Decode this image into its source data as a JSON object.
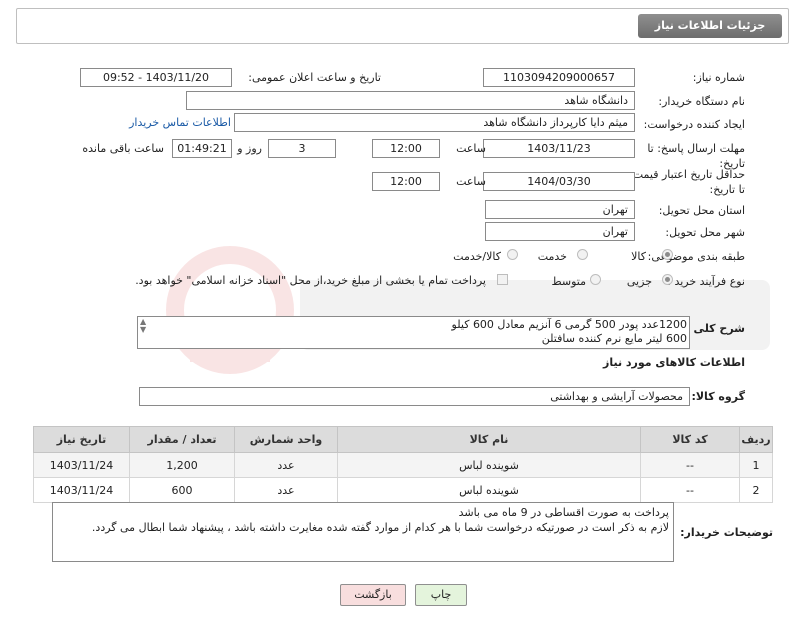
{
  "header": {
    "title": "جزئیات اطلاعات نیاز"
  },
  "fields": {
    "need_number_label": "شماره نیاز:",
    "need_number": "1103094209000657",
    "announce_label": "تاریخ و ساعت اعلان عمومی:",
    "announce_value": "1403/11/20 - 09:52",
    "buyer_org_label": "نام دستگاه خریدار:",
    "buyer_org": "دانشگاه شاهد",
    "requester_label": "ایجاد کننده درخواست:",
    "requester": "میثم دایا کارپرداز دانشگاه شاهد",
    "contact_link": "اطلاعات تماس خریدار",
    "deadline_label": "مهلت ارسال پاسخ: تا تاریخ:",
    "deadline_date": "1403/11/23",
    "time_label": "ساعت",
    "deadline_time": "12:00",
    "days_value": "3",
    "days_label": "روز و",
    "remaining_time": "01:49:21",
    "remaining_label": "ساعت باقی مانده",
    "validity_label": "حداقل تاریخ اعتبار قیمت: تا تاریخ:",
    "validity_date": "1404/03/30",
    "validity_time": "12:00",
    "province_label": "استان محل تحویل:",
    "province": "تهران",
    "city_label": "شهر محل تحویل:",
    "city": "تهران",
    "category_label": "طبقه بندی موضوعی:",
    "category_options": [
      "کالا",
      "خدمت",
      "کالا/خدمت"
    ],
    "process_label": "نوع فرآیند خرید :",
    "process_options": [
      "جزیی",
      "متوسط"
    ],
    "payment_note": "پرداخت تمام یا بخشی از مبلغ خرید،از محل \"اسناد خزانه اسلامی\" خواهد بود.",
    "summary_label": "شرح کلی نیاز:",
    "summary_line1": "1200عدد پودر 500 گرمی 6 آنزیم معادل 600 کیلو",
    "summary_line2": "600 لیتر مایع نرم کننده سافتلن"
  },
  "goods": {
    "section_title": "اطلاعات کالاهای مورد نیاز",
    "group_label": "گروه کالا:",
    "group_value": "محصولات آرایشی و بهداشتی",
    "columns": [
      "ردیف",
      "کد کالا",
      "نام کالا",
      "واحد شمارش",
      "تعداد / مقدار",
      "تاریخ نیاز"
    ],
    "rows": [
      [
        "1",
        "--",
        "شوینده لباس",
        "عدد",
        "1,200",
        "1403/11/24"
      ],
      [
        "2",
        "--",
        "شوینده لباس",
        "عدد",
        "600",
        "1403/11/24"
      ]
    ]
  },
  "buyer_notes": {
    "label": "توضیحات خریدار:",
    "line1": "پرداخت به صورت اقساطی در 9 ماه می باشد",
    "line2": "لازم به ذکر است در صورتیکه درخواست شما با هر کدام از موارد گفته شده مغایرت داشته باشد ، پیشنهاد شما ابطال می گردد."
  },
  "buttons": {
    "print": "چاپ",
    "back": "بازگشت"
  },
  "colors": {
    "title_bg": "#7d7d7d",
    "link": "#1a5aa6",
    "back_bg": "#f8dede",
    "print_bg": "#e4f4dc"
  }
}
